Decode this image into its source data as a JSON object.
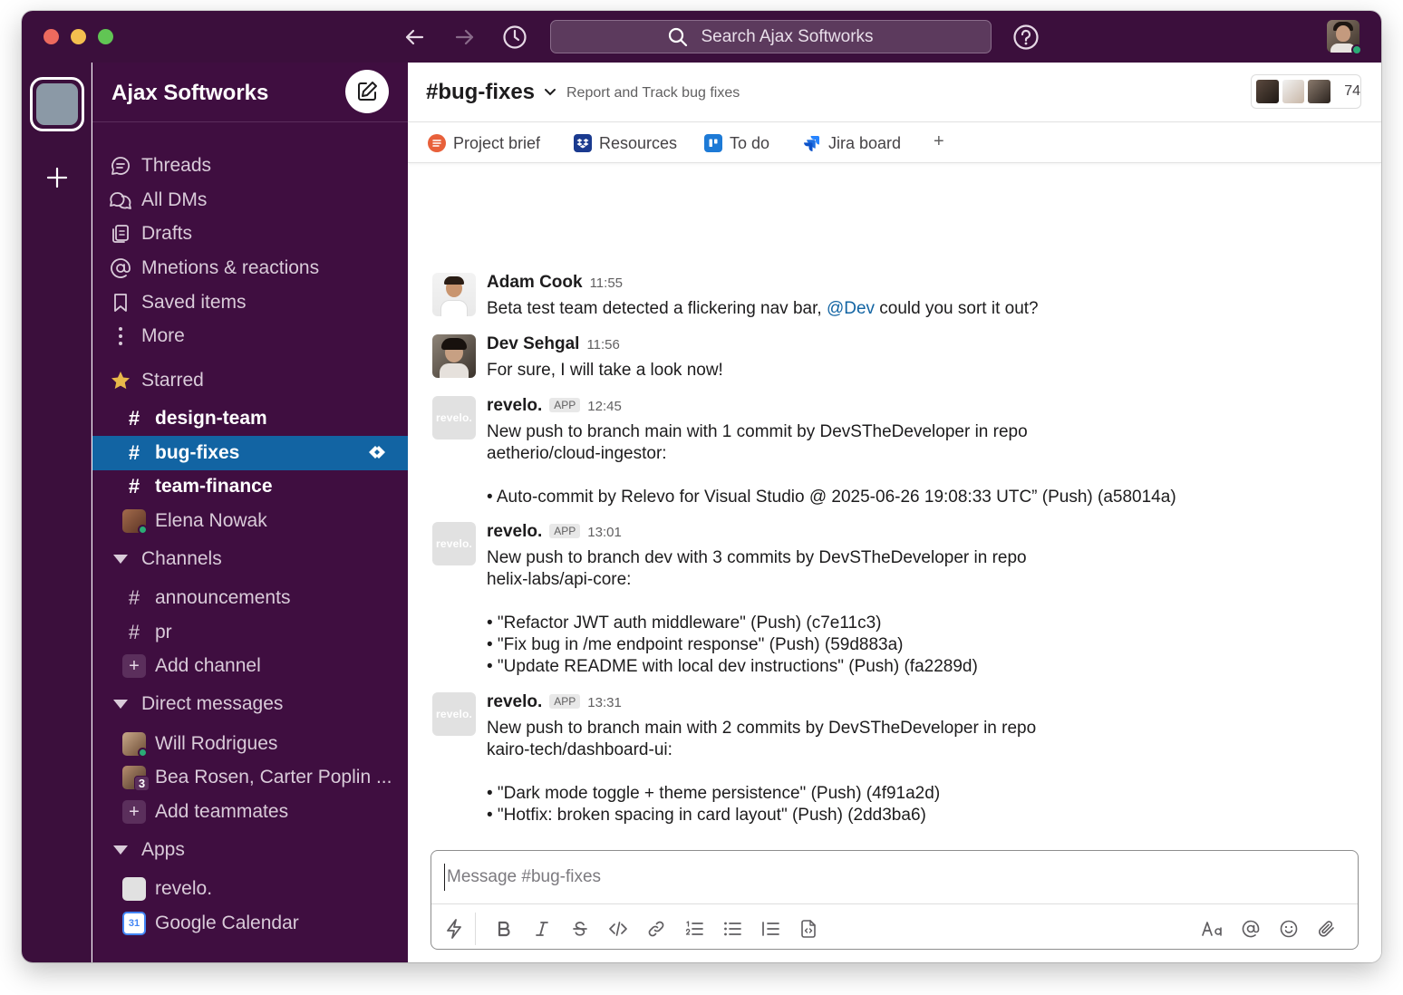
{
  "titlebar": {
    "search_placeholder": "Search Ajax Softworks"
  },
  "workspace": {
    "name": "Ajax Softworks"
  },
  "sidebar": {
    "nav": [
      {
        "label": "Threads",
        "icon": "threads-icon"
      },
      {
        "label": "All DMs",
        "icon": "dms-icon"
      },
      {
        "label": "Drafts",
        "icon": "drafts-icon"
      },
      {
        "label": "Mnetions & reactions",
        "icon": "at-icon"
      },
      {
        "label": "Saved items",
        "icon": "bookmark-icon"
      },
      {
        "label": "More",
        "icon": "more-icon"
      }
    ],
    "starred_label": "Starred",
    "starred": [
      {
        "label": "design-team",
        "prefix": "#"
      },
      {
        "label": "bug-fixes",
        "prefix": "#",
        "active": true
      },
      {
        "label": "team-finance",
        "prefix": "#"
      },
      {
        "label": "Elena Nowak",
        "type": "dm"
      }
    ],
    "channels_label": "Channels",
    "channels": [
      {
        "label": "announcements",
        "prefix": "#"
      },
      {
        "label": "pr",
        "prefix": "#"
      }
    ],
    "add_channel": "Add channel",
    "dms_label": "Direct messages",
    "dms": [
      {
        "label": "Will Rodrigues"
      },
      {
        "label": "Bea Rosen, Carter Poplin ...",
        "count": "3"
      }
    ],
    "add_teammates": "Add teammates",
    "apps_label": "Apps",
    "apps": [
      {
        "label": "revelo."
      },
      {
        "label": "Google Calendar",
        "icon_text": "31"
      }
    ]
  },
  "channel": {
    "name": "#bug-fixes",
    "topic": "Report and Track bug fixes",
    "member_count": "74",
    "bookmarks": [
      {
        "label": "Project brief"
      },
      {
        "label": "Resources"
      },
      {
        "label": "To do"
      },
      {
        "label": "Jira board"
      }
    ],
    "add_bookmark": "+"
  },
  "messages": [
    {
      "author": "Adam Cook",
      "time": "11:55",
      "text_before": "Beta test team detected a flickering nav bar, ",
      "mention": "@Dev",
      "text_after": " could you sort it out?"
    },
    {
      "author": "Dev Sehgal",
      "time": "11:56",
      "text": "For sure, I will take a look now!"
    },
    {
      "author": "revelo.",
      "badge": "APP",
      "time": "12:45",
      "avatar_text": "revelo.",
      "text": "New push to branch main with 1 commit by DevSTheDeveloper in repo\naetherio/cloud-ingestor:\n\n• Auto-commit by Relevo for Visual Studio @ 2025-06-26 19:08:33 UTC” (Push) (a58014a)"
    },
    {
      "author": "revelo.",
      "badge": "APP",
      "time": "13:01",
      "avatar_text": "revelo.",
      "text": "New push to branch dev with 3 commits by DevSTheDeveloper in repo\nhelix-labs/api-core:\n\n• \"Refactor JWT auth middleware\" (Push) (c7e11c3)\n• \"Fix bug in /me endpoint response\" (Push) (59d883a)\n• \"Update README with local dev instructions\" (Push) (fa2289d)"
    },
    {
      "author": "revelo.",
      "badge": "APP",
      "time": "13:31",
      "avatar_text": "revelo.",
      "text": "New push to branch main with 2 commits by DevSTheDeveloper in repo\nkairo-tech/dashboard-ui:\n\n• \"Dark mode toggle + theme persistence\" (Push) (4f91a2d)\n• \"Hotfix: broken spacing in card layout\" (Push) (2dd3ba6)"
    }
  ],
  "composer": {
    "placeholder": "Message #bug-fixes"
  },
  "colors": {
    "aubergine": "#3f0e40",
    "active": "#1264a3",
    "mention": "#1264a3",
    "presence": "#2bac76"
  }
}
